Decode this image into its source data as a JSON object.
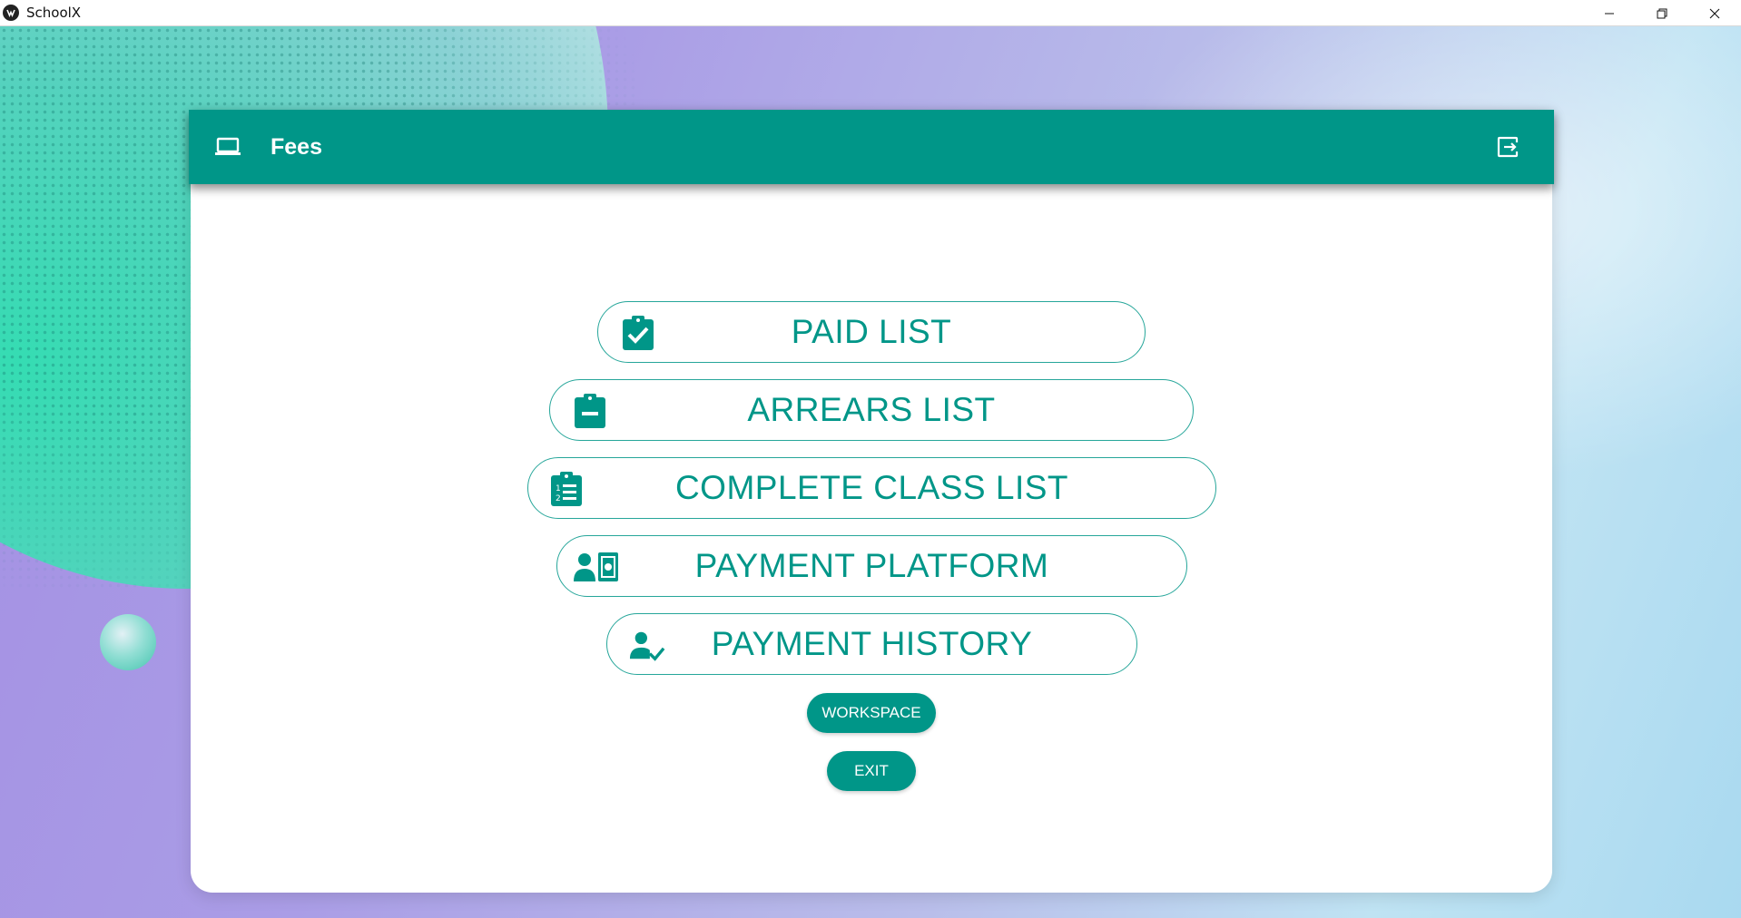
{
  "window": {
    "title": "SchoolX",
    "controls": [
      "minimize-icon",
      "restore-icon",
      "close-icon"
    ]
  },
  "toolbar": {
    "icon": "laptop-icon",
    "title": "Fees",
    "action_icon": "logout-icon"
  },
  "menu": {
    "items": [
      {
        "label": "PAID LIST",
        "icon": "clipboard-check-icon"
      },
      {
        "label": "ARREARS LIST",
        "icon": "clipboard-minus-icon"
      },
      {
        "label": "COMPLETE CLASS LIST",
        "icon": "clipboard-list-icon"
      },
      {
        "label": "PAYMENT PLATFORM",
        "icon": "user-cash-icon"
      },
      {
        "label": "PAYMENT HISTORY",
        "icon": "user-check-icon"
      }
    ],
    "workspace_label": "WORKSPACE",
    "exit_label": "EXIT"
  },
  "colors": {
    "primary": "#009688",
    "button_border": "#26a69a",
    "card_bg": "#ffffff"
  }
}
